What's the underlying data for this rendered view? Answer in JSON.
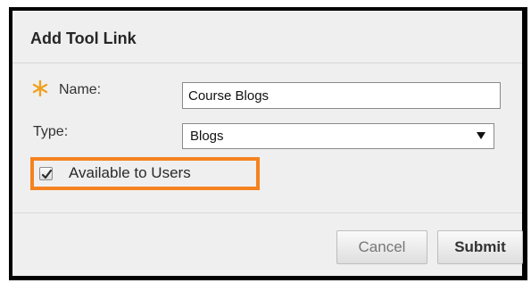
{
  "dialog": {
    "title": "Add Tool Link"
  },
  "form": {
    "name": {
      "label": "Name:",
      "required": true,
      "value": "Course Blogs"
    },
    "type": {
      "label": "Type:",
      "selected": "Blogs"
    },
    "available": {
      "label": "Available to Users",
      "checked": true
    }
  },
  "buttons": {
    "cancel_label": "Cancel",
    "submit_label": "Submit"
  },
  "icons": {
    "required": "asterisk-icon",
    "dropdown": "triangle-down-icon",
    "check": "checkmark-icon"
  },
  "colors": {
    "required_star": "#f0a020",
    "highlight": "#f58220",
    "dialog_bg": "#efefef"
  }
}
